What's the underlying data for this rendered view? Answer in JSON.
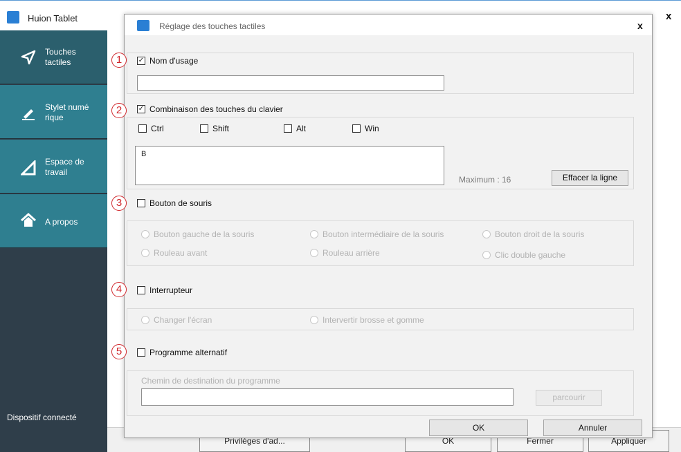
{
  "app": {
    "title": "Huion Tablet",
    "close": "x",
    "sidebar": {
      "items": [
        {
          "label": "Touches tactiles",
          "icon": "send-icon"
        },
        {
          "label": "Stylet numé rique",
          "icon": "pen-icon"
        },
        {
          "label": "Espace de travail",
          "icon": "triangle-icon"
        },
        {
          "label": "A propos",
          "icon": "home-icon"
        }
      ],
      "status": "Dispositif connecté"
    },
    "bottom_buttons": {
      "privileges": "Privilèges d'ad...",
      "ok": "OK",
      "close": "Fermer",
      "apply": "Appliquer"
    }
  },
  "dialog": {
    "title": "Réglage des touches tactiles",
    "close": "x",
    "sections": {
      "s1": {
        "number": "1",
        "checked": true,
        "label": "Nom d'usage",
        "value": ""
      },
      "s2": {
        "number": "2",
        "checked": true,
        "label": "Combinaison des touches du clavier",
        "modifiers": {
          "ctrl": "Ctrl",
          "shift": "Shift",
          "alt": "Alt",
          "win": "Win"
        },
        "key_value": "B",
        "maximum": "Maximum : 16",
        "clear_button": "Effacer la ligne"
      },
      "s3": {
        "number": "3",
        "checked": false,
        "label": "Bouton de souris",
        "options": {
          "left": "Bouton gauche de la souris",
          "middle": "Bouton intermédiaire de la souris",
          "right": "Bouton droit de la souris",
          "wheel_forward": "Rouleau avant",
          "wheel_back": "Rouleau arrière",
          "double_left": "Clic double gauche"
        }
      },
      "s4": {
        "number": "4",
        "checked": false,
        "label": "Interrupteur",
        "options": {
          "switch_screen": "Changer l'écran",
          "swap_brush": "Intervertir brosse et gomme"
        }
      },
      "s5": {
        "number": "5",
        "checked": false,
        "label": "Programme alternatif",
        "path_label": "Chemin de destination du programme",
        "path_value": "",
        "browse": "parcourir"
      }
    },
    "ok": "OK",
    "cancel": "Annuler"
  }
}
